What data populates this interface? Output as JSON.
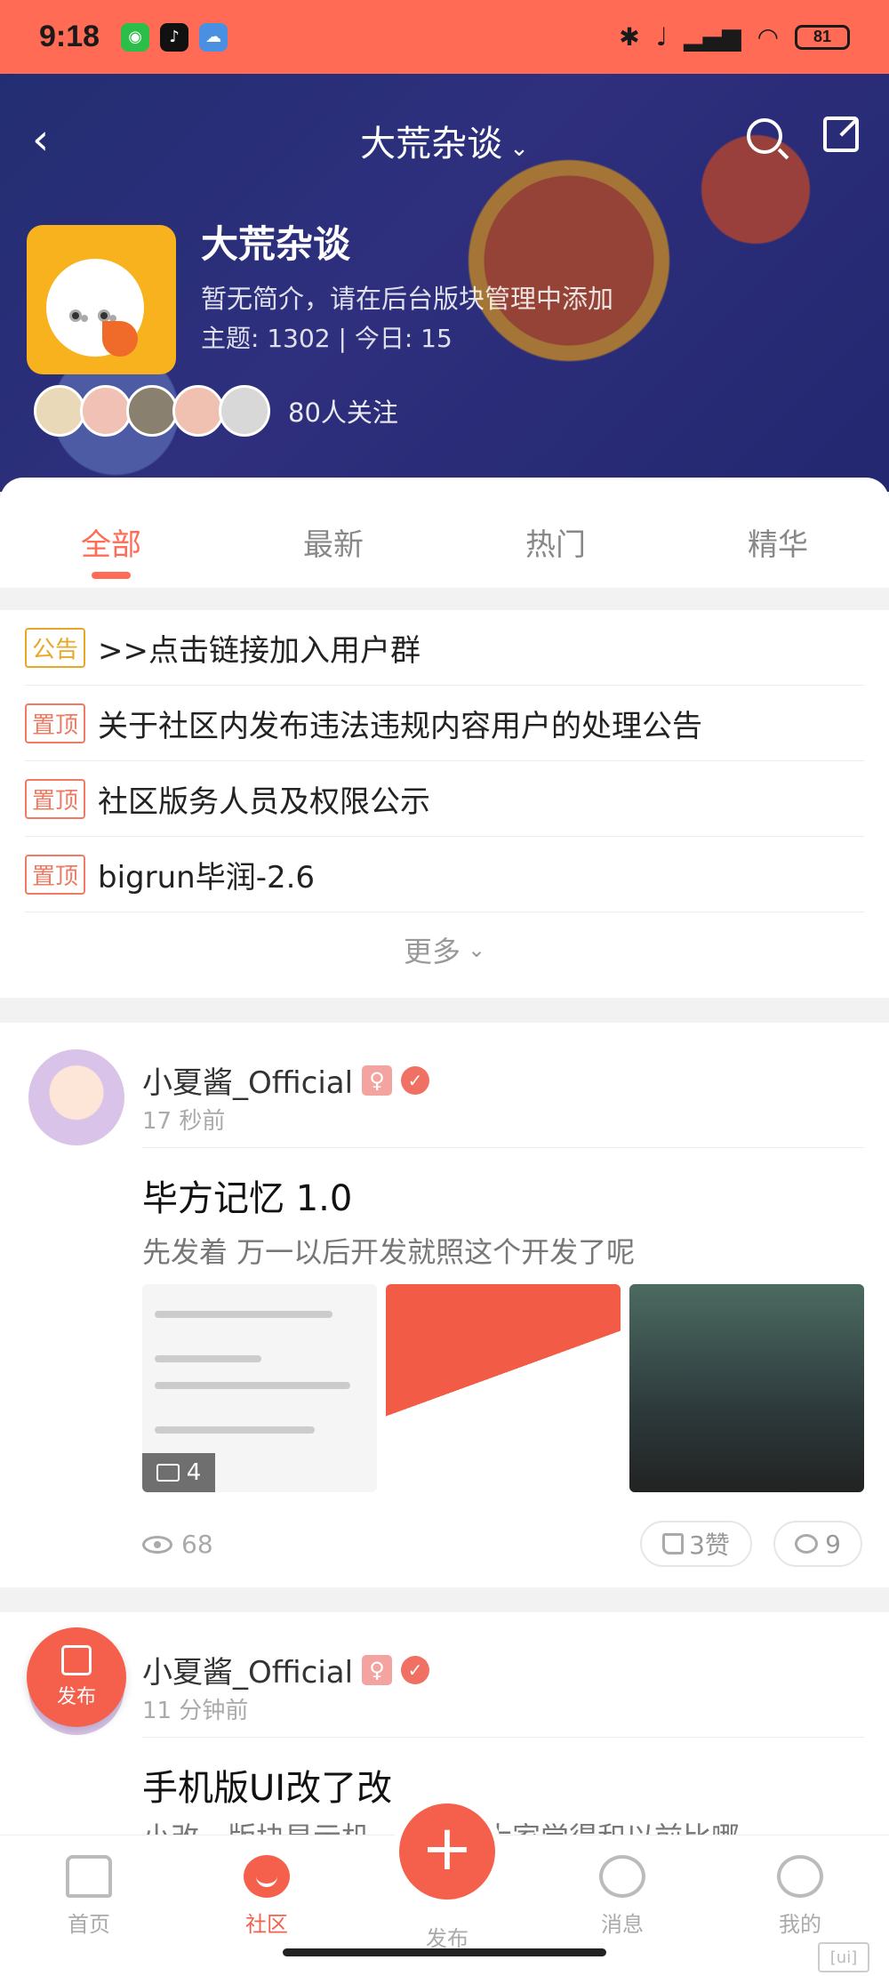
{
  "status_bar": {
    "time": "9:18",
    "battery": "81"
  },
  "header": {
    "title": "大荒杂谈",
    "forum_name": "大荒杂谈",
    "description": "暂无简介，请在后台版块管理中添加",
    "stats": "主题: 1302 | 今日: 15",
    "followers_text": "80人关注"
  },
  "tabs": [
    {
      "label": "全部"
    },
    {
      "label": "最新"
    },
    {
      "label": "热门"
    },
    {
      "label": "精华"
    }
  ],
  "notices": [
    {
      "tag": "公告",
      "text": ">>点击链接加入用户群"
    },
    {
      "tag": "置顶",
      "text": "关于社区内发布违法违规内容用户的处理公告"
    },
    {
      "tag": "置顶",
      "text": "社区版务人员及权限公示"
    },
    {
      "tag": "置顶",
      "text": "bigrun毕润-2.6"
    }
  ],
  "more_label": "更多",
  "posts": [
    {
      "author": "小夏酱_Official",
      "gender": "♀",
      "time": "17 秒前",
      "title": "毕方记忆 1.0",
      "excerpt": "先发着 万一以后开发就照这个开发了呢",
      "image_count": "4",
      "views": "68",
      "likes": "3赞",
      "comments": "9"
    },
    {
      "author": "小夏酱_Official",
      "gender": "♀",
      "time": "11 分钟前",
      "title": "手机版UI改了改",
      "excerpt": "小改一版块显示机……加…大家觉得和以前比哪"
    }
  ],
  "fab_label": "发布",
  "bottom_nav": [
    {
      "label": "首页"
    },
    {
      "label": "社区"
    },
    {
      "label": "发布"
    },
    {
      "label": "消息"
    },
    {
      "label": "我的"
    }
  ],
  "colors": {
    "accent": "#f4604b",
    "status_bar": "#ff6b55"
  }
}
